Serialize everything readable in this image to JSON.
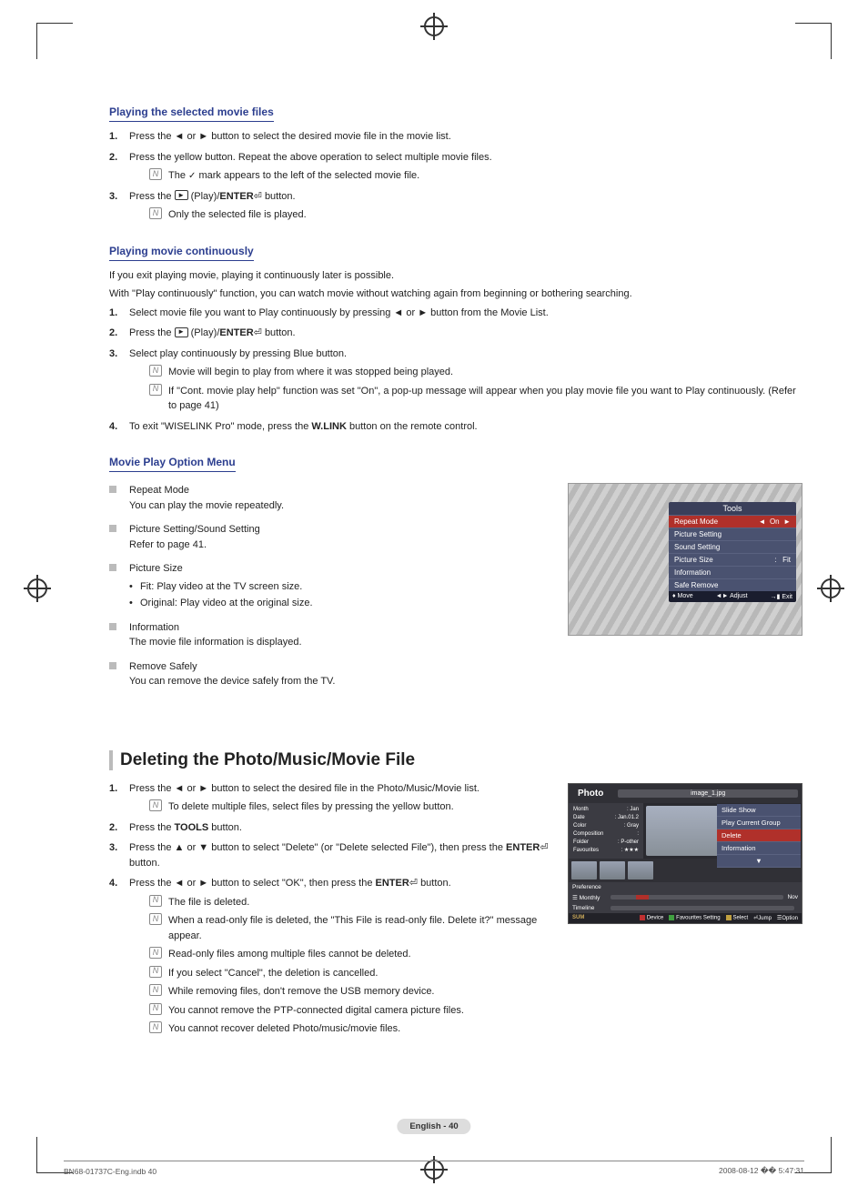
{
  "sec1": {
    "title": "Playing the selected movie files",
    "s1": "Press the ◄ or ► button to select the desired movie file in the movie list.",
    "s2": "Press the yellow button. Repeat the above operation to select multiple movie files.",
    "n2a": "mark appears to the left of the selected movie file.",
    "n2a_pre": "The",
    "s3a": "Press the",
    "s3b": "(Play)/",
    "s3c": "ENTER",
    "s3d": "button.",
    "n3a": "Only the selected file is played."
  },
  "sec2": {
    "title": "Playing movie continuously",
    "p1": "If you exit playing movie, playing it continuously later is possible.",
    "p2": "With \"Play continuously\" function, you can watch movie without watching again from beginning or bothering searching.",
    "s1": "Select movie file you want to Play continuously by pressing ◄ or ► button from the Movie List.",
    "s2a": "Press the",
    "s2b": "(Play)/",
    "s2c": "ENTER",
    "s2d": "button.",
    "s3": "Select play continuously by pressing Blue button.",
    "n3a": "Movie will begin to play from where it was stopped being played.",
    "n3b": "If \"Cont. movie play help\" function was set \"On\", a pop-up message will appear when you play movie file you want to Play continuously. (Refer to page 41)",
    "s4a": "To exit \"WISELINK Pro\" mode, press the",
    "s4b": "W.LINK",
    "s4c": "button on the remote control."
  },
  "sec3": {
    "title": "Movie Play Option Menu",
    "i1t": "Repeat Mode",
    "i1d": "You can play the movie repeatedly.",
    "i2t": "Picture Setting/Sound Setting",
    "i2d": "Refer to page 41.",
    "i3t": "Picture Size",
    "i3a": "Fit: Play video at the TV screen size.",
    "i3b": "Original: Play video at the original size.",
    "i4t": "Information",
    "i4d": "The movie file information is displayed.",
    "i5t": "Remove Safely",
    "i5d": "You can remove the device safely from the TV."
  },
  "tools": {
    "hdr": "Tools",
    "r1": "Repeat Mode",
    "r1v": "On",
    "r2": "Picture Setting",
    "r3": "Sound Setting",
    "r4": "Picture Size",
    "r4v": "Fit",
    "r5": "Information",
    "r6": "Safe Remove",
    "f1": "Move",
    "f2": "Adjust",
    "f3": "Exit"
  },
  "sec4": {
    "title": "Deleting the Photo/Music/Movie File",
    "s1": "Press the ◄ or ► button to select the desired file in the Photo/Music/Movie list.",
    "n1a": "To delete multiple files, select files by pressing the yellow button.",
    "s2a": "Press the",
    "s2b": "TOOLS",
    "s2c": "button.",
    "s3a": "Press the ▲ or ▼ button to select \"Delete\" (or \"Delete selected File\"), then press the",
    "s3b": "ENTER",
    "s3c": "button.",
    "s4a": "Press the ◄ or ► button to select \"OK\", then press the",
    "s4b": "ENTER",
    "s4c": "button.",
    "n4a": "The file is deleted.",
    "n4b": "When a read-only file is deleted, the \"This File is read-only file. Delete it?\" message appear.",
    "n4c": "Read-only files among multiple files cannot be deleted.",
    "n4d": "If you select \"Cancel\", the deletion is cancelled.",
    "n4e": "While removing files, don't remove the USB memory device.",
    "n4f": "You cannot remove the PTP-connected digital camera picture files.",
    "n4g": "You cannot recover deleted Photo/music/movie files."
  },
  "photo": {
    "title": "Photo",
    "filename": "image_1.jpg",
    "meta": {
      "Month": "Jan",
      "Date": "Jan.01.2",
      "Color": "Gray",
      "Composition": "",
      "Folder": "P-other",
      "Favourites": "★★★"
    },
    "menu": {
      "m1": "Slide Show",
      "m2": "Play Current Group",
      "m3": "Delete",
      "m4": "Information"
    },
    "pref": "Preference",
    "monthly": "Monthly",
    "nov": "Nov",
    "timeline": "Timeline",
    "sum": "SUM",
    "l1": "Device",
    "l2": "Favourites Setting",
    "l3": "Select",
    "l4": "Jump",
    "l5": "Option"
  },
  "pagenum": "English - 40",
  "footL": "BN68-01737C-Eng.indb   40",
  "footR": "2008-08-12   �� 5:47:31"
}
